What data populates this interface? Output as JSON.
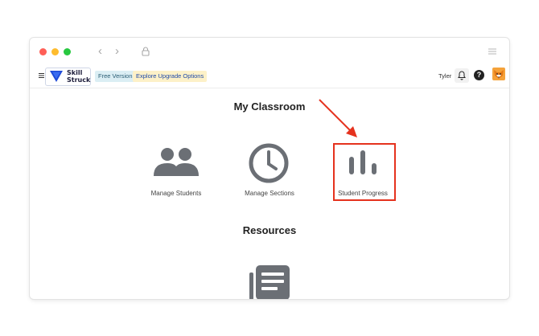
{
  "browser": {
    "nav_back_icon": "chevron-left-icon",
    "nav_forward_icon": "chevron-right-icon",
    "lock_icon": "lock-icon",
    "menu_icon": "menu-lines-icon"
  },
  "appbar": {
    "logo_line1": "Skill",
    "logo_line2": "Struck",
    "free_badge": "Free Version",
    "upgrade_badge": "Explore Upgrade Options",
    "username": "Tyler",
    "help_glyph": "?"
  },
  "main": {
    "title": "My Classroom",
    "tiles": [
      {
        "label": "Manage Students",
        "icon": "people-icon"
      },
      {
        "label": "Manage Sections",
        "icon": "clock-icon"
      },
      {
        "label": "Student Progress",
        "icon": "bar-chart-icon",
        "highlighted": true
      }
    ],
    "annotation": {
      "color": "#e5321e"
    },
    "resources_title": "Resources"
  },
  "colors": {
    "icon_gray": "#6b6f75",
    "logo_blue": "#1f4bd8",
    "accent_red": "#e5321e"
  }
}
